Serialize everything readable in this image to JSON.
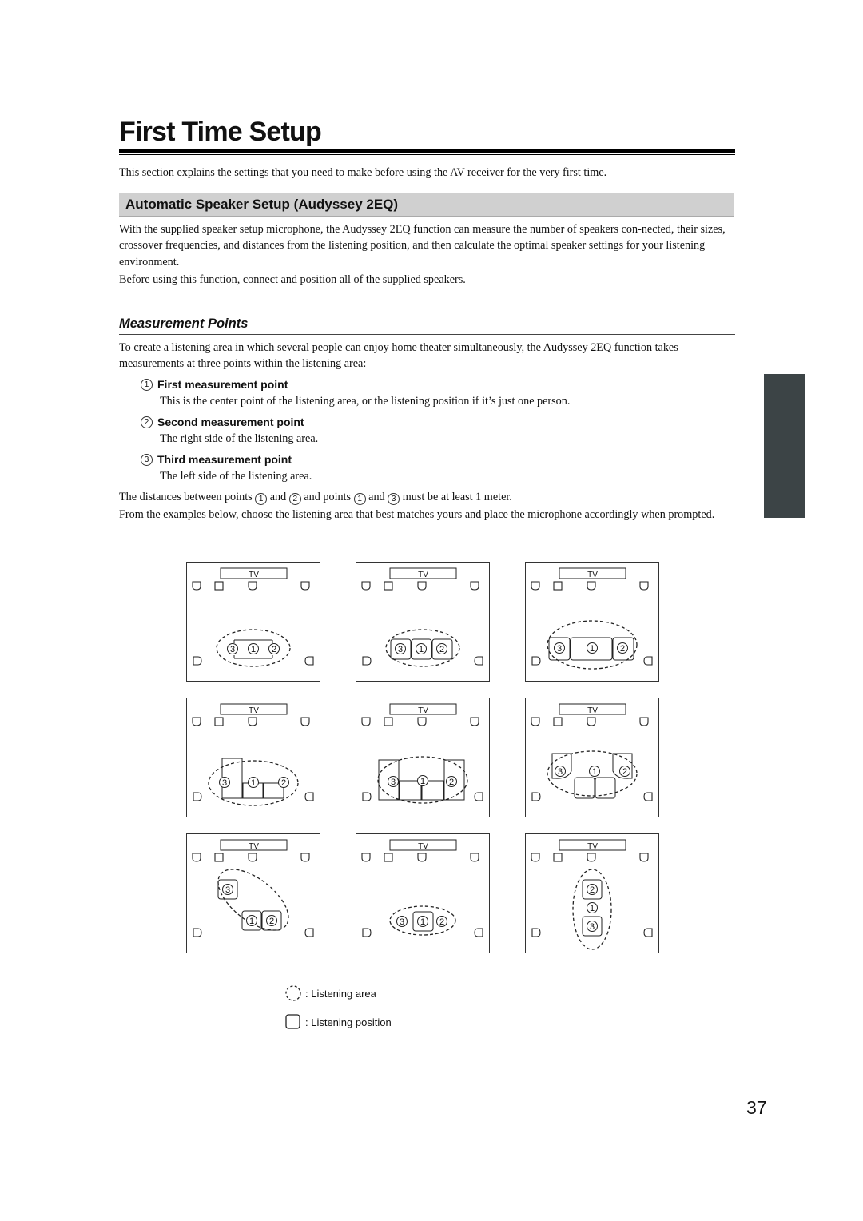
{
  "page": {
    "title": "First Time Setup",
    "intro": "This section explains the settings that you need to make before using the AV receiver for the very first time.",
    "page_number": "37",
    "side_tab_color": "#3c4446"
  },
  "section": {
    "title": "Automatic Speaker Setup (Audyssey 2EQ)",
    "bar_color": "#d0d0d0",
    "para1": "With the supplied speaker setup microphone, the Audyssey 2EQ function can measure the number of speakers con-nected, their sizes, crossover frequencies, and distances from the listening position, and then calculate the optimal speaker settings for your listening environment.",
    "para2": "Before using this function, connect and position all of the supplied speakers."
  },
  "measurement": {
    "title": "Measurement Points",
    "intro": "To create a listening area in which several people can enjoy home theater simultaneously, the Audyssey 2EQ function takes measurements at three points within the listening area:",
    "points": [
      {
        "num": "1",
        "title": "First measurement point",
        "desc": "This is the center point of the listening area, or the listening position if it’s just one person."
      },
      {
        "num": "2",
        "title": "Second measurement point",
        "desc": "The right side of the listening area."
      },
      {
        "num": "3",
        "title": "Third measurement point",
        "desc": "The left side of the listening area."
      }
    ],
    "distance_note": {
      "t1": "The distances between points",
      "n1": "1",
      "t2": "and",
      "n2": "2",
      "t3": "and points",
      "n3": "1",
      "t4": "and",
      "n4": "3",
      "t5": "must be at least 1 meter."
    },
    "examples_note": "From the examples below, choose the listening area that best matches yours and place the microphone accordingly when prompted."
  },
  "diagrams": {
    "tv_label": "TV",
    "items": [
      {
        "layout": "sofa-row-single",
        "points": [
          "3",
          "1",
          "2"
        ]
      },
      {
        "layout": "three-seats",
        "points": [
          "3",
          "1",
          "2"
        ]
      },
      {
        "layout": "wide-sofa",
        "points": [
          "3",
          "1",
          "2"
        ]
      },
      {
        "layout": "l-sectional",
        "points": [
          "3",
          "1",
          "2"
        ]
      },
      {
        "layout": "u-sectional",
        "points": [
          "3",
          "1",
          "2"
        ]
      },
      {
        "layout": "sofa-with-armchairs",
        "points": [
          "3",
          "1",
          "2"
        ]
      },
      {
        "layout": "diagonal",
        "points": [
          "3",
          "1",
          "2"
        ]
      },
      {
        "layout": "single-seat",
        "points": [
          "3",
          "1",
          "2"
        ]
      },
      {
        "layout": "front-back",
        "points": [
          "2",
          "1",
          "3"
        ]
      }
    ]
  },
  "legend": {
    "area": ": Listening area",
    "position": ": Listening position"
  }
}
